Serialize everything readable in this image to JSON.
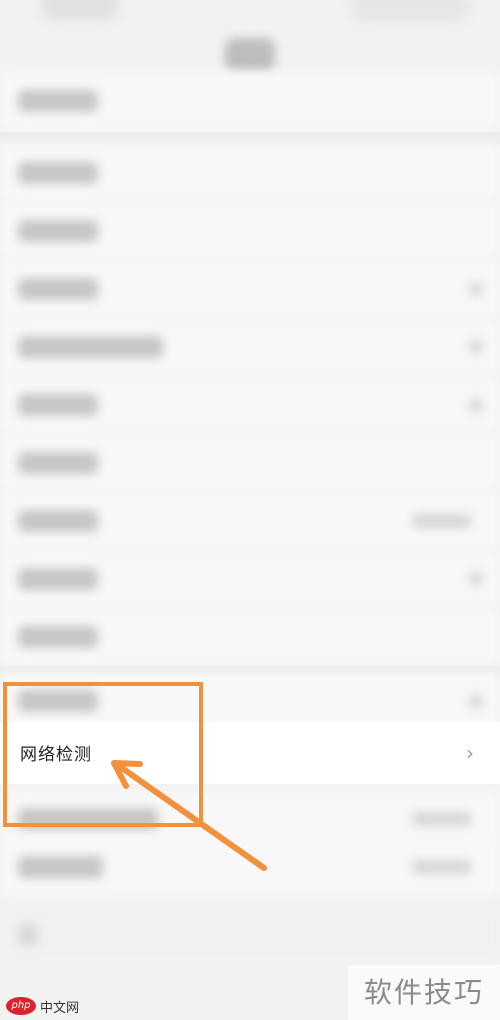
{
  "settings": {
    "focused_item": {
      "label": "网络检测",
      "chevron": "›"
    }
  },
  "icons": {
    "chevron": "chevron-right-icon",
    "arrow": "annotation-arrow-icon"
  },
  "colors": {
    "highlight": "#f2913d",
    "background": "#f2f2f2",
    "row": "#f8f8f8"
  },
  "watermark": {
    "right_text": "软件技巧",
    "left_badge": "php",
    "left_text": "中文网"
  }
}
